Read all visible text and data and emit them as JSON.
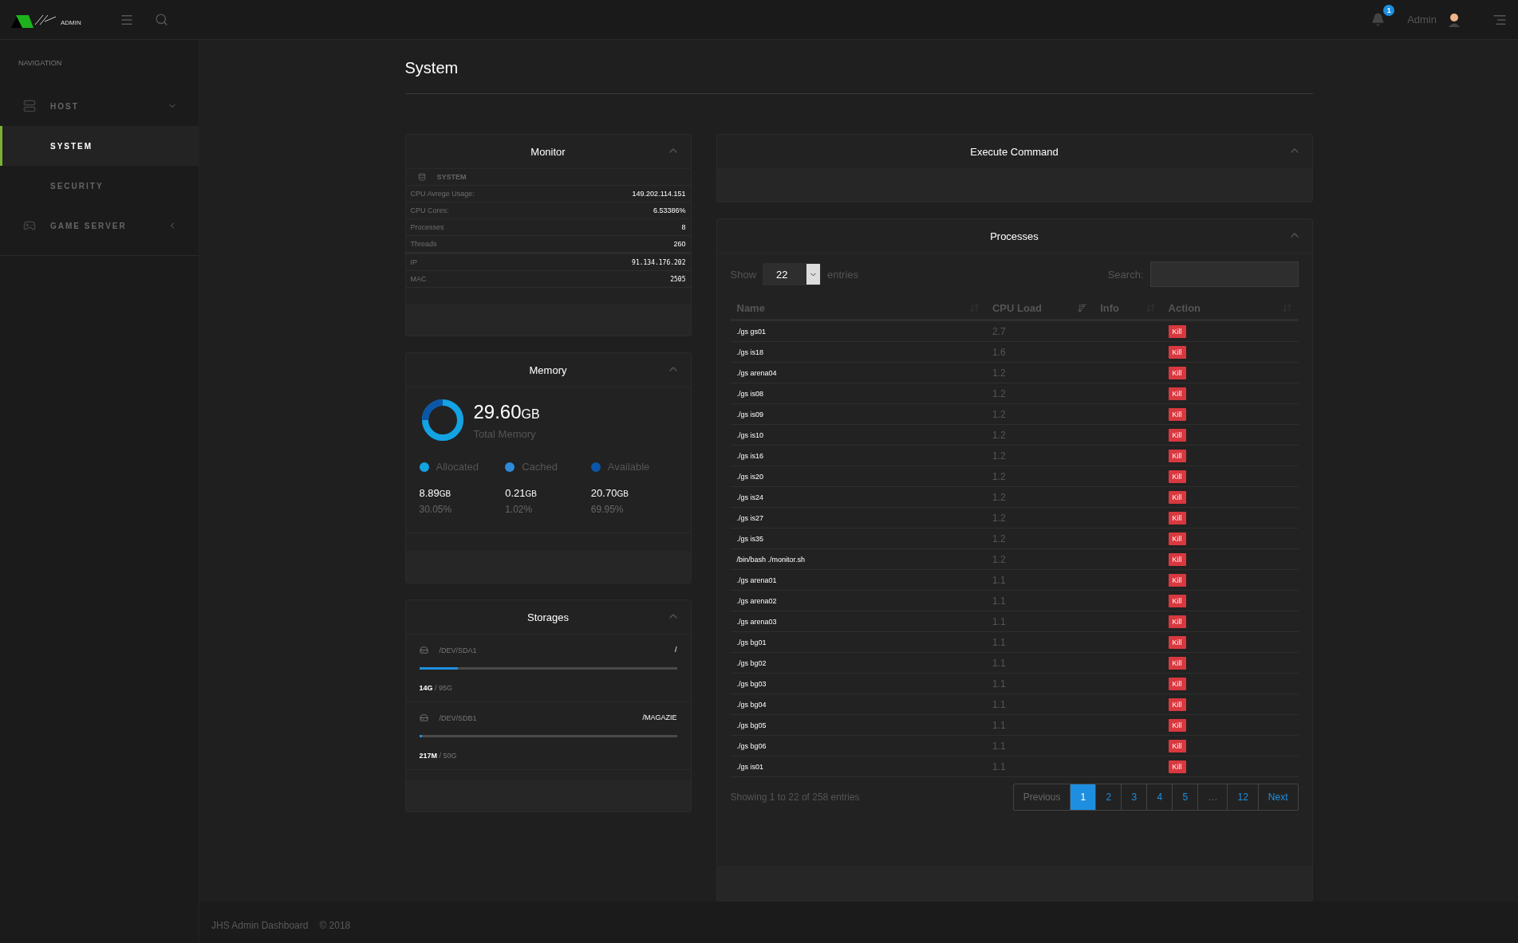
{
  "topbar": {
    "logo_text": "ADMIN",
    "notifications": "1",
    "user": "Admin"
  },
  "sidebar": {
    "heading": "NAVIGATION",
    "items": [
      {
        "label": "HOST",
        "expanded": true,
        "selected": false,
        "children": [
          {
            "label": "SYSTEM",
            "selected": true
          },
          {
            "label": "SECURITY",
            "selected": false
          }
        ]
      },
      {
        "label": "GAME SERVER",
        "expanded": false,
        "selected": false
      }
    ]
  },
  "page_title": "System",
  "monitor": {
    "title": "Monitor",
    "section": "SYSTEM",
    "rows": [
      {
        "label": "CPU Avrege Usage:",
        "value": "149.202.114.151",
        "kind": "text"
      },
      {
        "label": "CPU Cores:",
        "value": "6.53386%",
        "kind": "text"
      },
      {
        "label": "Processes",
        "value": "8",
        "kind": "text"
      },
      {
        "label": "Threads",
        "value": "260",
        "kind": "text"
      },
      {
        "label": "IP",
        "value": "91.134.176.202",
        "kind": "code"
      },
      {
        "label": "MAC",
        "value": "2505",
        "kind": "code"
      }
    ]
  },
  "memory": {
    "title": "Memory",
    "total": "29.60",
    "total_unit": "GB",
    "total_label": "Total Memory",
    "legend": [
      {
        "label": "Allocated",
        "color": "#13a3e3",
        "amount": "8.89",
        "unit": "GB",
        "percent": "30.05%"
      },
      {
        "label": "Cached",
        "color": "#2d8ad6",
        "amount": "0.21",
        "unit": "GB",
        "percent": "1.02%"
      },
      {
        "label": "Available",
        "color": "#0b56a6",
        "amount": "20.70",
        "unit": "GB",
        "percent": "69.95%"
      }
    ]
  },
  "storages": {
    "title": "Storages",
    "items": [
      {
        "device": "/DEV/SDA1",
        "mount": "/",
        "level": 0.15,
        "used": "14G",
        "total": "/ 95G"
      },
      {
        "device": "/DEV/SDB1",
        "mount": "/MAGAZIE",
        "level": 0.01,
        "used": "217M",
        "total": "/ 50G"
      }
    ]
  },
  "execute": {
    "title": "Execute Command"
  },
  "processes": {
    "title": "Processes",
    "show_label": "Show",
    "page_size": "22",
    "entries_label": "entries",
    "search_label": "Search:",
    "columns": [
      {
        "label": "Name",
        "sorted": false
      },
      {
        "label": "CPU Load",
        "sorted": true
      },
      {
        "label": "Info",
        "sorted": false
      },
      {
        "label": "Action",
        "sorted": false
      }
    ],
    "rows": [
      {
        "name": "./gs gs01",
        "cpu": "2.7",
        "action": "Kill"
      },
      {
        "name": "./gs is18",
        "cpu": "1.6",
        "action": "Kill"
      },
      {
        "name": "./gs arena04",
        "cpu": "1.2",
        "action": "Kill"
      },
      {
        "name": "./gs is08",
        "cpu": "1.2",
        "action": "Kill"
      },
      {
        "name": "./gs is09",
        "cpu": "1.2",
        "action": "Kill"
      },
      {
        "name": "./gs is10",
        "cpu": "1.2",
        "action": "Kill"
      },
      {
        "name": "./gs is16",
        "cpu": "1.2",
        "action": "Kill"
      },
      {
        "name": "./gs is20",
        "cpu": "1.2",
        "action": "Kill"
      },
      {
        "name": "./gs is24",
        "cpu": "1.2",
        "action": "Kill"
      },
      {
        "name": "./gs is27",
        "cpu": "1.2",
        "action": "Kill"
      },
      {
        "name": "./gs is35",
        "cpu": "1.2",
        "action": "Kill"
      },
      {
        "name": "/bin/bash ./monitor.sh",
        "cpu": "1.2",
        "action": "Kill"
      },
      {
        "name": "./gs arena01",
        "cpu": "1.1",
        "action": "Kill"
      },
      {
        "name": "./gs arena02",
        "cpu": "1.1",
        "action": "Kill"
      },
      {
        "name": "./gs arena03",
        "cpu": "1.1",
        "action": "Kill"
      },
      {
        "name": "./gs bg01",
        "cpu": "1.1",
        "action": "Kill"
      },
      {
        "name": "./gs bg02",
        "cpu": "1.1",
        "action": "Kill"
      },
      {
        "name": "./gs bg03",
        "cpu": "1.1",
        "action": "Kill"
      },
      {
        "name": "./gs bg04",
        "cpu": "1.1",
        "action": "Kill"
      },
      {
        "name": "./gs bg05",
        "cpu": "1.1",
        "action": "Kill"
      },
      {
        "name": "./gs bg06",
        "cpu": "1.1",
        "action": "Kill"
      },
      {
        "name": "./gs is01",
        "cpu": "1.1",
        "action": "Kill"
      }
    ],
    "info": "Showing 1 to 22 of 258 entries",
    "pagination": [
      {
        "label": "Previous",
        "selected": false,
        "disabled": true
      },
      {
        "label": "1",
        "selected": true,
        "disabled": false
      },
      {
        "label": "2",
        "selected": false,
        "disabled": false
      },
      {
        "label": "3",
        "selected": false,
        "disabled": false
      },
      {
        "label": "4",
        "selected": false,
        "disabled": false
      },
      {
        "label": "5",
        "selected": false,
        "disabled": false
      },
      {
        "label": "…",
        "selected": false,
        "disabled": true
      },
      {
        "label": "12",
        "selected": false,
        "disabled": false
      },
      {
        "label": "Next",
        "selected": false,
        "disabled": false
      }
    ]
  },
  "footer": {
    "text": "JHS Admin Dashboard",
    "copyright": "© 2018"
  }
}
